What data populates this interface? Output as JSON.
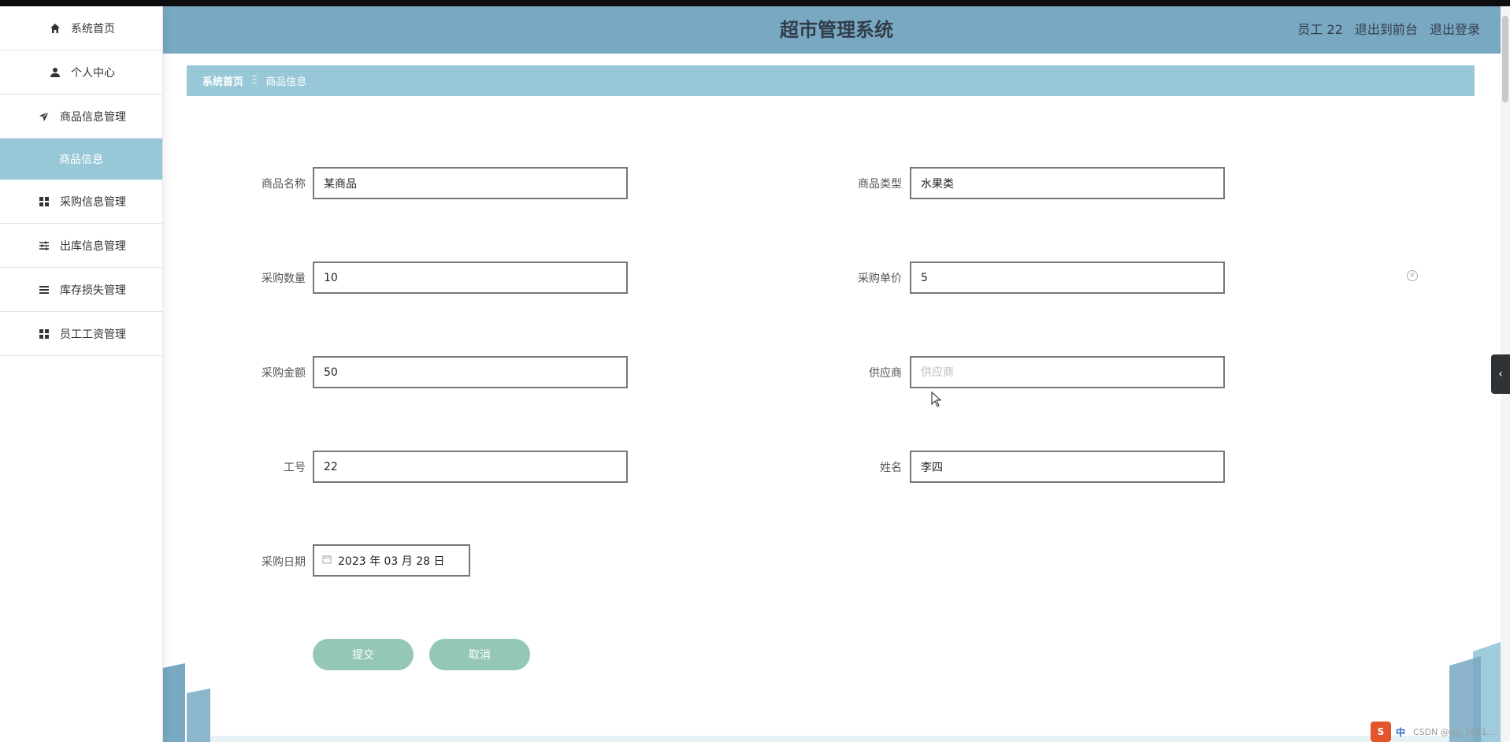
{
  "app": {
    "title": "超市管理系统"
  },
  "userbar": {
    "user": "员工 22",
    "to_front": "退出到前台",
    "logout": "退出登录"
  },
  "sidebar": {
    "items": [
      {
        "label": "系统首页",
        "icon": "home-icon"
      },
      {
        "label": "个人中心",
        "icon": "user-icon"
      },
      {
        "label": "商品信息管理",
        "icon": "send-icon"
      },
      {
        "label": "商品信息",
        "sub": true
      },
      {
        "label": "采购信息管理",
        "icon": "grid-icon"
      },
      {
        "label": "出库信息管理",
        "icon": "sliders-icon"
      },
      {
        "label": "库存损失管理",
        "icon": "list-icon"
      },
      {
        "label": "员工工资管理",
        "icon": "grid-icon"
      }
    ]
  },
  "breadcrumb": {
    "home": "系统首页",
    "separator": "Ξ",
    "current": "商品信息"
  },
  "form": {
    "product_name": {
      "label": "商品名称",
      "value": "某商品"
    },
    "product_type": {
      "label": "商品类型",
      "value": "水果类"
    },
    "purchase_qty": {
      "label": "采购数量",
      "value": "10"
    },
    "unit_price": {
      "label": "采购单价",
      "value": "5"
    },
    "amount": {
      "label": "采购金额",
      "value": "50"
    },
    "supplier": {
      "label": "供应商",
      "value": "",
      "placeholder": "供应商"
    },
    "emp_no": {
      "label": "工号",
      "value": "22"
    },
    "name": {
      "label": "姓名",
      "value": "李四"
    },
    "purchase_date": {
      "label": "采购日期",
      "value": "2023 年 03 月 28 日"
    }
  },
  "buttons": {
    "submit": "提交",
    "cancel": "取消"
  },
  "ime": {
    "lang": "中",
    "watermark": "CSDN @qq_1661..."
  },
  "colors": {
    "header": "#78a8c2",
    "accent": "#98c8d8",
    "button": "#94c7b6"
  }
}
